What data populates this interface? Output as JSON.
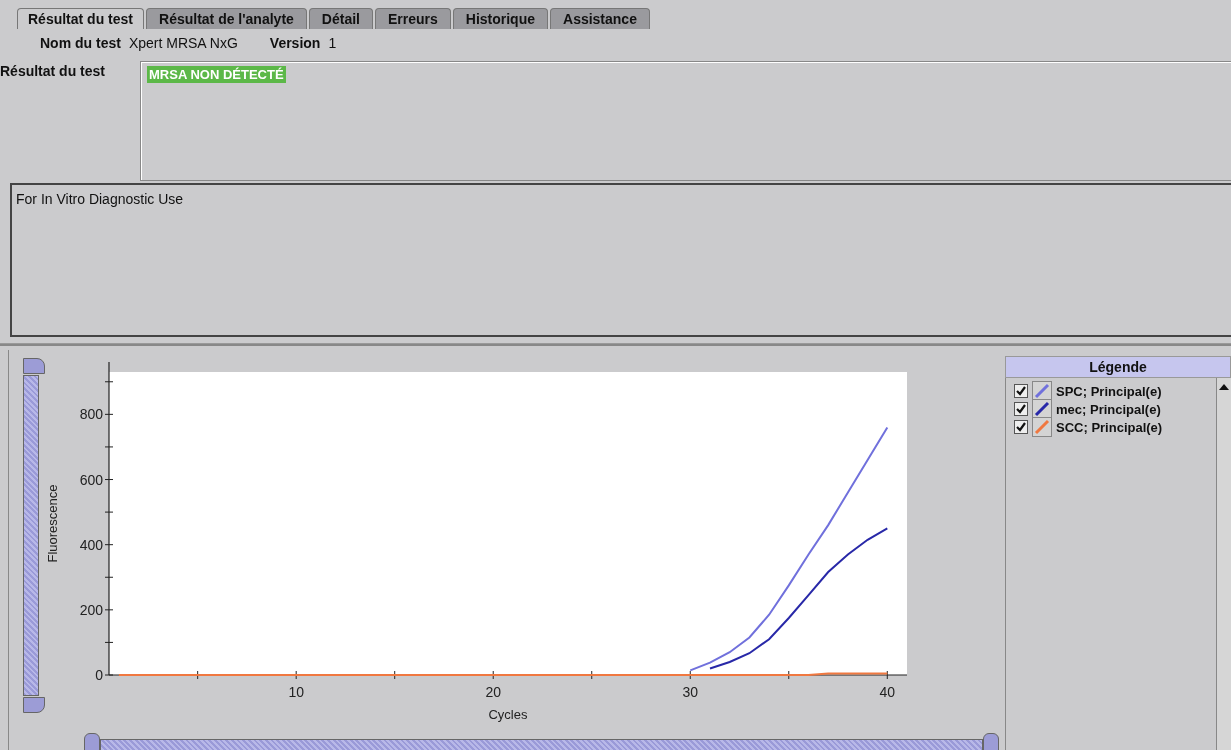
{
  "tabs": [
    {
      "label": "Résultat du test",
      "selected": true
    },
    {
      "label": "Résultat de l'analyte",
      "selected": false
    },
    {
      "label": "Détail",
      "selected": false
    },
    {
      "label": "Erreurs",
      "selected": false
    },
    {
      "label": "Historique",
      "selected": false
    },
    {
      "label": "Assistance",
      "selected": false
    }
  ],
  "test_name": {
    "label": "Nom du test",
    "value": "Xpert MRSA NxG"
  },
  "version": {
    "label": "Version",
    "value": "1"
  },
  "test_result": {
    "label": "Résultat du test",
    "value": "MRSA NON DÉTECTÉ",
    "color": "#5cb848"
  },
  "notes": "For In Vitro Diagnostic Use",
  "y_range_slider": {
    "level": 1
  },
  "x_range_slider": {
    "level": 1
  },
  "legend": {
    "title": "Légende",
    "items": [
      {
        "checked": true
      },
      {
        "checked": true
      },
      {
        "checked": true
      }
    ]
  },
  "chart_data": {
    "type": "line",
    "xlabel": "Cycles",
    "ylabel": "Fluorescence",
    "x": [
      1,
      2,
      3,
      4,
      5,
      6,
      7,
      8,
      9,
      10,
      11,
      12,
      13,
      14,
      15,
      16,
      17,
      18,
      19,
      20,
      21,
      22,
      23,
      24,
      25,
      26,
      27,
      28,
      29,
      30,
      31,
      32,
      33,
      34,
      35,
      36,
      37,
      38,
      39,
      40
    ],
    "xlim": [
      0.5,
      41
    ],
    "ylim": [
      0,
      930
    ],
    "xticks": [
      10,
      20,
      30,
      40
    ],
    "yticks": [
      0,
      200,
      400,
      600,
      800
    ],
    "series": [
      {
        "name": "SPC; Principal(e)",
        "color": "#7070dc",
        "values": [
          null,
          null,
          null,
          null,
          null,
          null,
          null,
          null,
          null,
          null,
          null,
          null,
          null,
          null,
          null,
          null,
          null,
          null,
          null,
          null,
          null,
          null,
          null,
          null,
          null,
          null,
          null,
          null,
          null,
          14,
          38,
          70,
          115,
          185,
          275,
          370,
          460,
          560,
          660,
          760
        ]
      },
      {
        "name": "mec; Principal(e)",
        "color": "#2828a8",
        "values": [
          null,
          null,
          null,
          null,
          null,
          null,
          null,
          null,
          null,
          null,
          null,
          null,
          null,
          null,
          null,
          null,
          null,
          null,
          null,
          null,
          null,
          null,
          null,
          null,
          null,
          null,
          null,
          null,
          null,
          null,
          20,
          40,
          67,
          110,
          175,
          245,
          316,
          370,
          415,
          450
        ]
      },
      {
        "name": "SCC; Principal(e)",
        "color": "#f07840",
        "values": [
          0,
          0,
          0,
          0,
          0,
          0,
          0,
          0,
          0,
          0,
          0,
          0,
          0,
          0,
          0,
          0,
          0,
          0,
          0,
          0,
          0,
          0,
          0,
          0,
          0,
          0,
          0,
          0,
          0,
          0,
          0,
          0,
          0,
          0,
          0,
          0,
          5,
          5,
          5,
          5
        ]
      }
    ]
  }
}
